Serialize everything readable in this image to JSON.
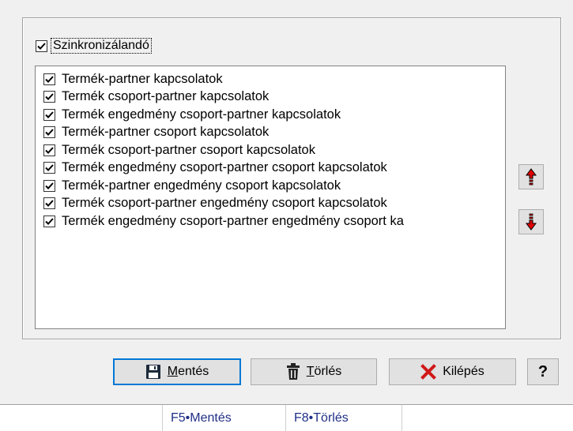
{
  "sync_checkbox": {
    "label": "Szinkronizálandó",
    "checked": true
  },
  "items": [
    "Termék-partner kapcsolatok",
    "Termék csoport-partner kapcsolatok",
    "Termék engedmény csoport-partner kapcsolatok",
    "Termék-partner csoport kapcsolatok",
    "Termék csoport-partner csoport kapcsolatok",
    "Termék engedmény csoport-partner csoport kapcsolatok",
    "Termék-partner engedmény csoport kapcsolatok",
    "Termék csoport-partner engedmény csoport kapcsolatok",
    "Termék engedmény csoport-partner engedmény csoport ka"
  ],
  "buttons": {
    "save_underline": "M",
    "save_rest": "entés",
    "delete_underline": "T",
    "delete_rest": "örlés",
    "exit": "Kilépés",
    "help": "?"
  },
  "statusbar": {
    "save": "F5•Mentés",
    "delete": "F8•Törlés"
  },
  "colors": {
    "accent": "#0078d7",
    "arrow": "#e00000",
    "exit_x": "#d01818"
  }
}
